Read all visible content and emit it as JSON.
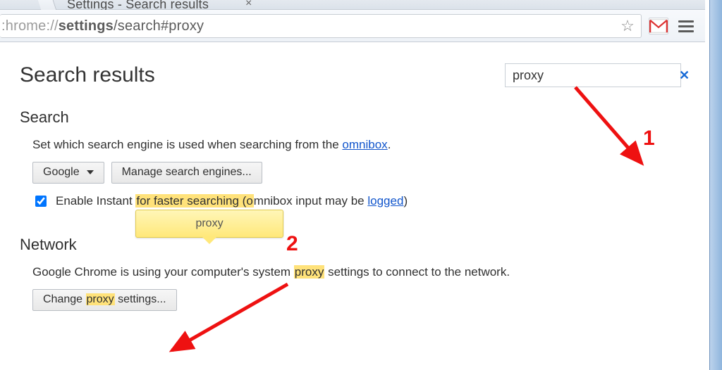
{
  "tab": {
    "title_fragment": "Settings - Search results"
  },
  "omnibox": {
    "scheme": ":hrome://",
    "bold": "settings",
    "rest": "/search#proxy"
  },
  "page": {
    "title": "Search results"
  },
  "search": {
    "value": "proxy"
  },
  "section_search": {
    "title": "Search",
    "desc_pre": "Set which search engine is used when searching from the ",
    "desc_link": "omnibox",
    "desc_post": ".",
    "engine_btn": "Google",
    "manage_btn": "Manage search engines...",
    "checkbox_pre": "Enable Instant ",
    "checkbox_hl": "for faster searching (o",
    "checkbox_mid": "mnibox input may be ",
    "checkbox_link": "logged",
    "checkbox_post": ")"
  },
  "tooltip": {
    "text": "proxy"
  },
  "section_network": {
    "title": "Network",
    "desc_pre": "Google Chrome is using your computer's system ",
    "desc_hl": "proxy",
    "desc_post": " settings to connect to the network.",
    "btn_pre": "Change ",
    "btn_hl": "proxy",
    "btn_post": " settings..."
  },
  "anno": {
    "one": "1",
    "two": "2"
  }
}
